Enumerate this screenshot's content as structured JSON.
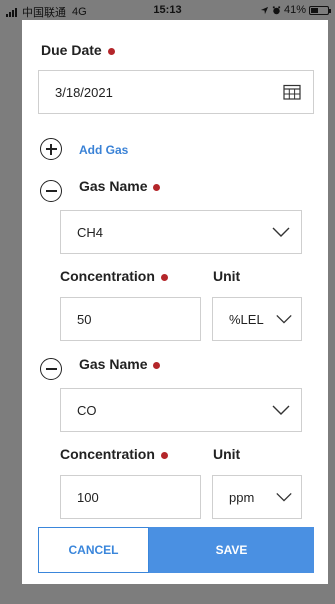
{
  "status_bar": {
    "carrier": "中国联通",
    "network": "4G",
    "time": "15:13",
    "battery": "41%",
    "battery_level": 0.41
  },
  "form": {
    "due_date": {
      "label": "Due Date",
      "value": "3/18/2021"
    },
    "add_gas": {
      "label": "Add Gas"
    },
    "gases": [
      {
        "name_label": "Gas Name",
        "name_value": "CH4",
        "concentration_label": "Concentration",
        "concentration_value": "50",
        "unit_label": "Unit",
        "unit_value": "%LEL"
      },
      {
        "name_label": "Gas Name",
        "name_value": "CO",
        "concentration_label": "Concentration",
        "concentration_value": "100",
        "unit_label": "Unit",
        "unit_value": "ppm"
      }
    ]
  },
  "footer": {
    "cancel_label": "CANCEL",
    "save_label": "SAVE"
  },
  "colors": {
    "accent": "#4a90e2",
    "required_dot": "#b4262a",
    "link": "#3a82d6",
    "backdrop": "#7d7d7d"
  },
  "icons": {
    "calendar": "calendar-icon",
    "add": "plus-circle-icon",
    "remove": "minus-circle-icon",
    "dropdown": "chevron-down-icon",
    "signal": "signal-icon",
    "battery": "battery-icon",
    "location": "location-arrow-icon",
    "alarm": "alarm-icon"
  }
}
